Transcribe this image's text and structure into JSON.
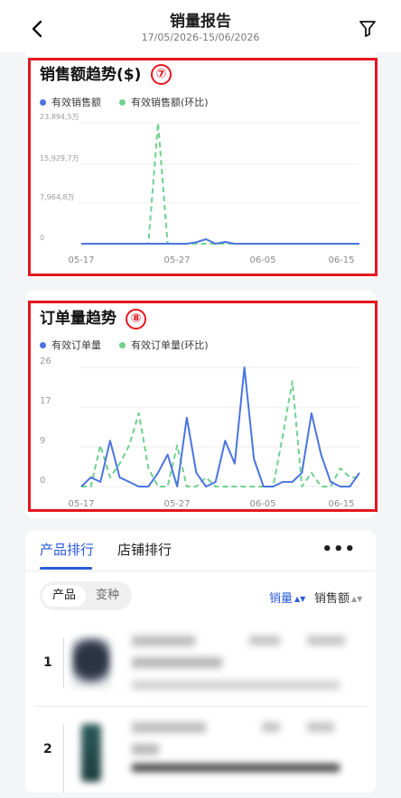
{
  "header": {
    "title": "销量报告",
    "date_range": "17/05/2026-15/06/2026",
    "back_icon": "chevron-left-icon",
    "filter_icon": "filter-icon"
  },
  "colors": {
    "accent": "#2a5bd7",
    "series_primary": "#4a74e0",
    "series_compare": "#6fd18f",
    "highlight_box": "#e5161f"
  },
  "chart_data": [
    {
      "type": "line",
      "title": "销售额趋势($)",
      "badge": "⑦",
      "x": [
        "05-17",
        "05-18",
        "05-19",
        "05-20",
        "05-21",
        "05-22",
        "05-23",
        "05-24",
        "05-25",
        "05-26",
        "05-27",
        "05-28",
        "05-29",
        "05-30",
        "05-31",
        "06-01",
        "06-02",
        "06-03",
        "06-04",
        "06-05",
        "06-06",
        "06-07",
        "06-08",
        "06-09",
        "06-10",
        "06-11",
        "06-12",
        "06-13",
        "06-14",
        "06-15"
      ],
      "x_tick_labels": [
        "05-17",
        "05-27",
        "06-05",
        "06-15"
      ],
      "y_tick_labels": [
        "0",
        "7,964,8万",
        "15,929,7万",
        "23,894,5万"
      ],
      "ylim": [
        0,
        23894.5
      ],
      "legend": [
        "有效销售额",
        "有效销售额(环比)"
      ],
      "series": [
        {
          "name": "有效销售额",
          "style": "solid",
          "values": [
            0,
            0,
            0,
            0,
            0,
            0,
            0,
            0,
            0,
            0,
            0,
            0,
            300,
            900,
            0,
            350,
            0,
            0,
            0,
            0,
            0,
            0,
            0,
            0,
            0,
            0,
            0,
            0,
            0,
            0
          ]
        },
        {
          "name": "有效销售额(环比)",
          "style": "dashed",
          "values": [
            0,
            0,
            0,
            0,
            0,
            0,
            0,
            0,
            23894.5,
            0,
            0,
            0,
            0,
            0,
            0,
            0,
            0,
            0,
            0,
            0,
            0,
            0,
            0,
            0,
            0,
            0,
            0,
            0,
            0,
            0
          ]
        }
      ]
    },
    {
      "type": "line",
      "title": "订单量趋势",
      "badge": "⑧",
      "x": [
        "05-17",
        "05-18",
        "05-19",
        "05-20",
        "05-21",
        "05-22",
        "05-23",
        "05-24",
        "05-25",
        "05-26",
        "05-27",
        "05-28",
        "05-29",
        "05-30",
        "05-31",
        "06-01",
        "06-02",
        "06-03",
        "06-04",
        "06-05",
        "06-06",
        "06-07",
        "06-08",
        "06-09",
        "06-10",
        "06-11",
        "06-12",
        "06-13",
        "06-14",
        "06-15"
      ],
      "x_tick_labels": [
        "05-17",
        "05-27",
        "06-05",
        "06-15"
      ],
      "y_tick_labels": [
        "0",
        "9",
        "17",
        "26"
      ],
      "ylim": [
        0,
        26
      ],
      "legend": [
        "有效订单量",
        "有效订单量(环比)"
      ],
      "series": [
        {
          "name": "有效订单量",
          "style": "solid",
          "values": [
            0,
            2,
            1,
            10,
            2,
            1,
            0,
            0,
            3,
            7,
            0,
            15,
            3,
            0,
            1,
            10,
            5,
            26,
            6,
            0,
            0,
            1,
            1,
            3,
            16,
            7,
            1,
            0,
            0,
            3
          ]
        },
        {
          "name": "有效订单量(环比)",
          "style": "dashed",
          "values": [
            0,
            0,
            9,
            2,
            5,
            9,
            16,
            4,
            0,
            0,
            9,
            0,
            0,
            2,
            0,
            0,
            0,
            0,
            0,
            0,
            0,
            11,
            23,
            0,
            3,
            0,
            0,
            4,
            2,
            2
          ]
        }
      ]
    }
  ],
  "ranking": {
    "tabs": [
      "产品排行",
      "店铺排行"
    ],
    "more_label": "•••",
    "segments": [
      "产品",
      "变种"
    ],
    "sort_sales": "销量",
    "sort_amount": "销售额",
    "rows": [
      {
        "rank": "1"
      },
      {
        "rank": "2"
      }
    ]
  }
}
